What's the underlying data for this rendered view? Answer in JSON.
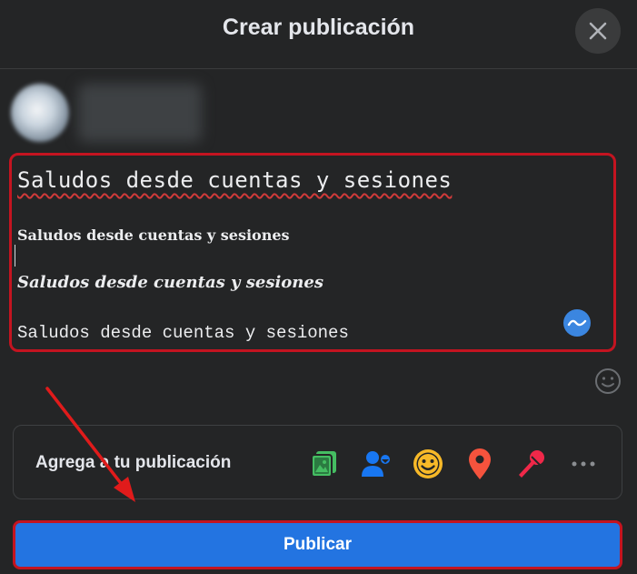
{
  "header": {
    "title": "Crear publicación"
  },
  "composer": {
    "lines": [
      "Saludos desde cuentas y sesiones",
      "Saludos desde cuentas y sesiones",
      "Saludos desde cuentas y sesiones",
      "Saludos desde cuentas y sesiones"
    ]
  },
  "add_to_post": {
    "label": "Agrega a tu publicación",
    "tools": [
      "photo-video-icon",
      "tag-people-icon",
      "feeling-icon",
      "check-in-icon",
      "live-video-icon",
      "more-icon"
    ]
  },
  "publish": {
    "label": "Publicar"
  },
  "colors": {
    "background": "#242526",
    "accent": "#2374e1",
    "highlight_red": "#c41420"
  }
}
